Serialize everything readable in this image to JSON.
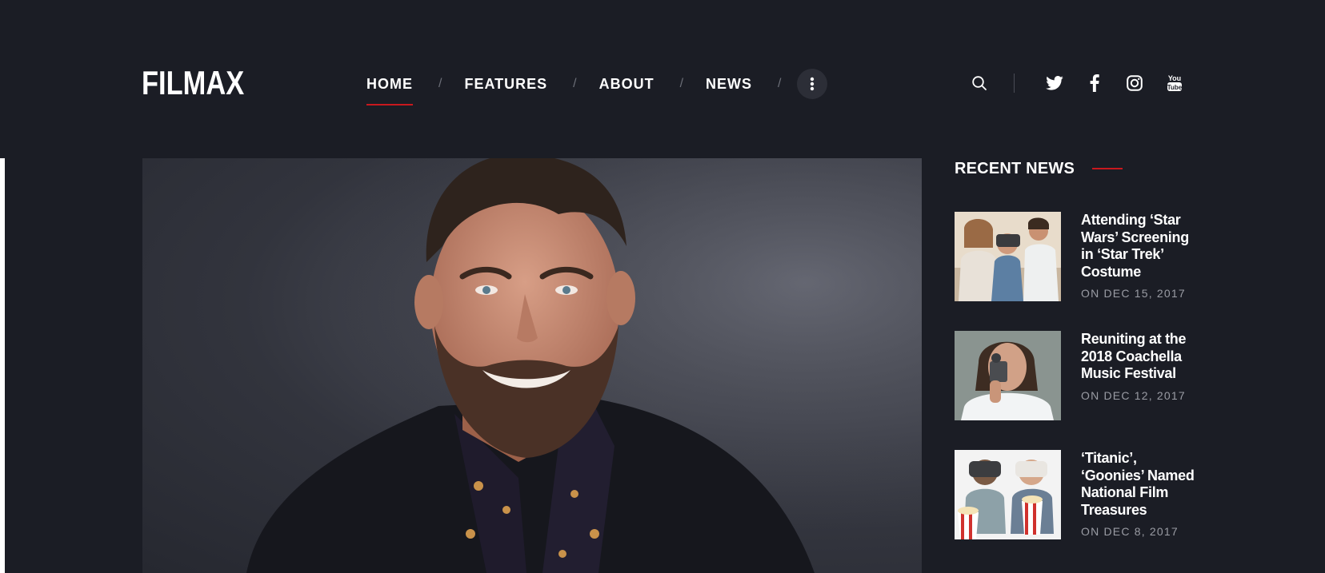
{
  "brand": {
    "logo_text": "FILMAX"
  },
  "nav": {
    "items": [
      {
        "label": "HOME",
        "active": true
      },
      {
        "label": "FEATURES",
        "active": false
      },
      {
        "label": "ABOUT",
        "active": false
      },
      {
        "label": "NEWS",
        "active": false
      }
    ],
    "separator": "/",
    "more_icon": "vertical-dots-icon"
  },
  "header_actions": {
    "search_icon": "search-icon",
    "social_icons": [
      "twitter-icon",
      "facebook-icon",
      "instagram-icon",
      "youtube-icon"
    ]
  },
  "sidebar": {
    "title": "RECENT NEWS",
    "items": [
      {
        "title": "Attending ‘Star Wars’ Screening in ‘Star Trek’ Costume",
        "date": "ON DEC 15, 2017"
      },
      {
        "title": "Reuniting at the 2018 Coachella Music Festival",
        "date": "ON DEC 12, 2017"
      },
      {
        "title": "‘Titanic’, ‘Goonies’ Named National Film Treasures",
        "date": "ON DEC 8, 2017"
      }
    ]
  },
  "colors": {
    "background": "#1b1d25",
    "accent": "#c8181e",
    "text": "#ffffff",
    "muted": "#9a9ca4"
  }
}
